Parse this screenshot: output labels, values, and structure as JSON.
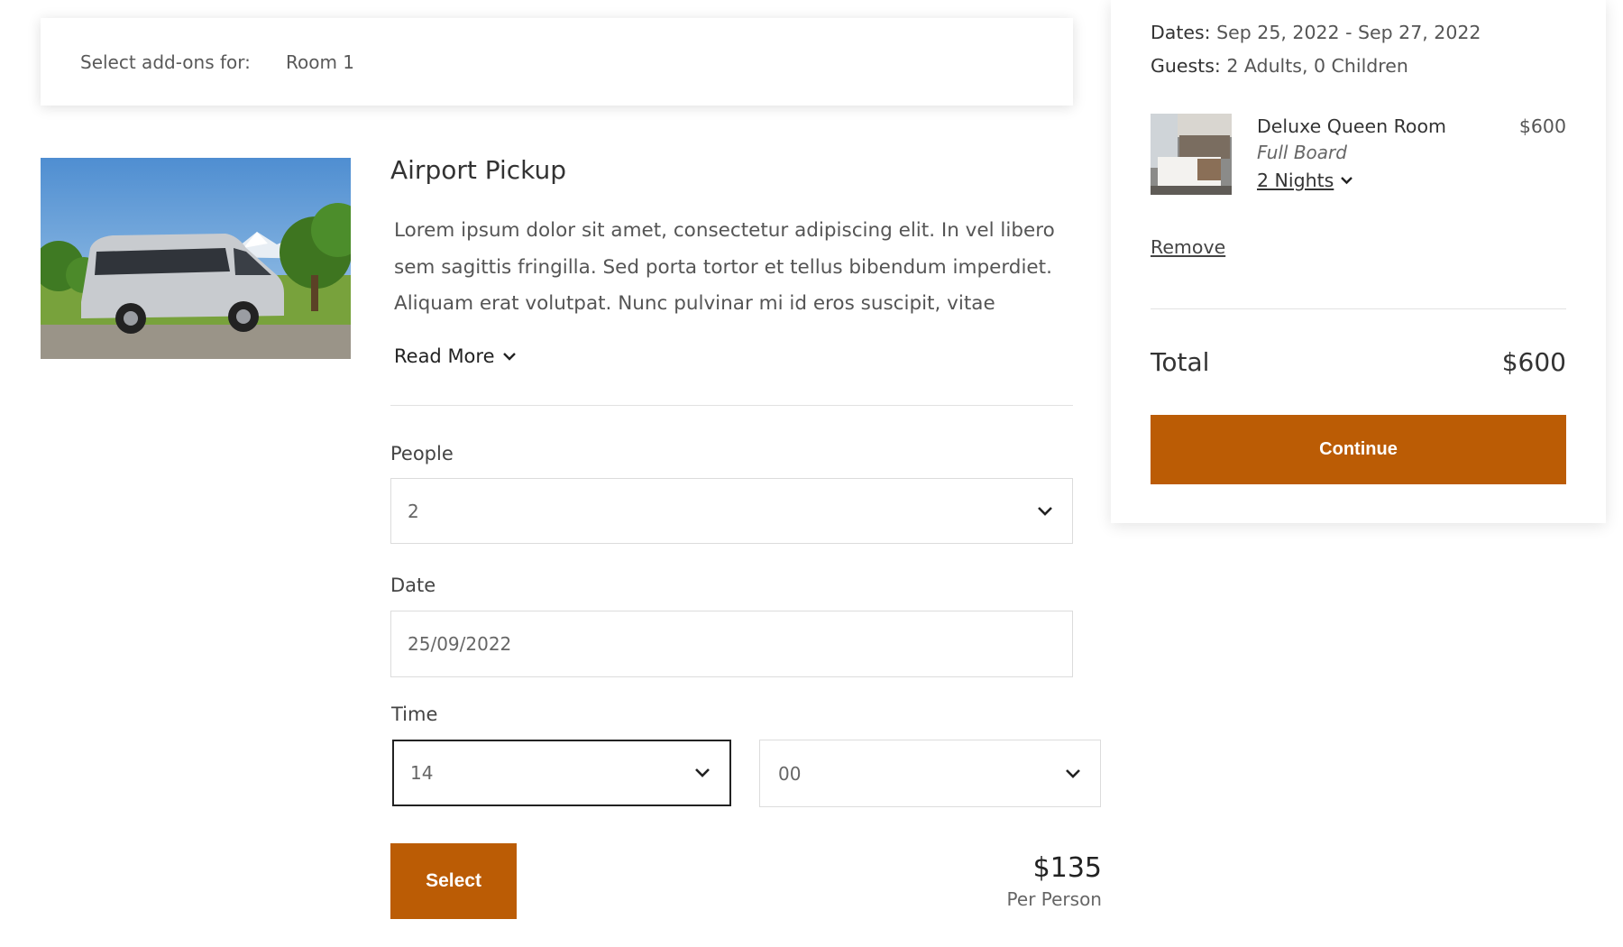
{
  "addon_header": {
    "label": "Select add-ons for:",
    "room": "Room 1"
  },
  "addon": {
    "title": "Airport Pickup",
    "description": "Lorem ipsum dolor sit amet, consectetur adipiscing elit. In vel libero sem sagittis fringilla. Sed porta tortor et tellus bibendum imperdiet. Aliquam erat volutpat. Nunc pulvinar mi id eros suscipit, vitae",
    "read_more": "Read More",
    "people": {
      "label": "People",
      "value": "2"
    },
    "date": {
      "label": "Date",
      "value": "25/09/2022"
    },
    "time": {
      "label": "Time",
      "hour": "14",
      "minute": "00"
    },
    "select_label": "Select",
    "price": "$135",
    "price_unit": "Per Person"
  },
  "summary": {
    "dates_key": "Dates:",
    "dates_value": "Sep 25, 2022 - Sep 27, 2022",
    "guests_key": "Guests:",
    "guests_value": "2 Adults, 0 Children",
    "room": {
      "name": "Deluxe Queen Room",
      "board": "Full Board",
      "nights": "2 Nights",
      "price": "$600"
    },
    "remove_label": "Remove",
    "total_label": "Total",
    "total_value": "$600",
    "continue_label": "Continue"
  },
  "colors": {
    "accent": "#bb5c05",
    "text": "#333333",
    "muted": "#666666",
    "border": "#dcdcdc"
  },
  "icons": {
    "chevron": "chevron-down-icon",
    "product_image": "van-photo",
    "room_image": "bedroom-photo"
  }
}
